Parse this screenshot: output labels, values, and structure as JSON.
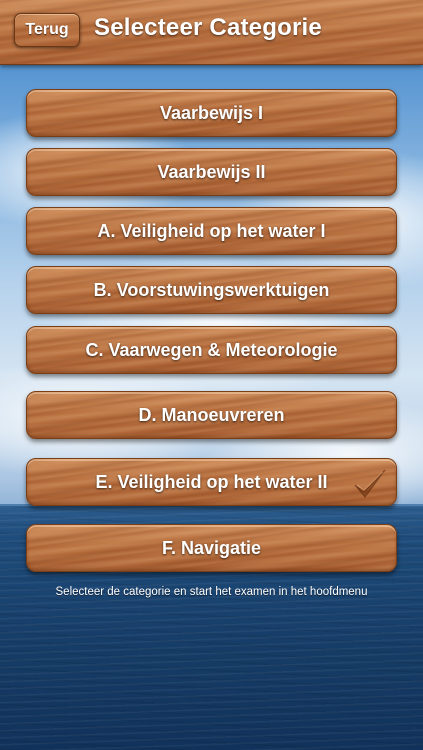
{
  "header": {
    "back_label": "Terug",
    "title": "Selecteer Categorie"
  },
  "categories": [
    {
      "label": "Vaarbewijs I",
      "selected": false
    },
    {
      "label": "Vaarbewijs II",
      "selected": false
    },
    {
      "label": "A. Veiligheid op het water I",
      "selected": false
    },
    {
      "label": "B. Voorstuwingswerktuigen",
      "selected": false
    },
    {
      "label": "C. Vaarwegen & Meteorologie",
      "selected": false
    },
    {
      "label": "D. Manoeuvreren",
      "selected": false
    },
    {
      "label": "E. Veiligheid op het water II",
      "selected": true,
      "icon": "checkmark-icon"
    },
    {
      "label": "F. Navigatie",
      "selected": false
    }
  ],
  "footer": {
    "hint": "Selecteer de categorie en start het examen in het hoofdmenu"
  },
  "colors": {
    "wood": "#b8703f",
    "sky": "#8db9e2",
    "sea": "#1a4471",
    "text": "#ffffff"
  }
}
